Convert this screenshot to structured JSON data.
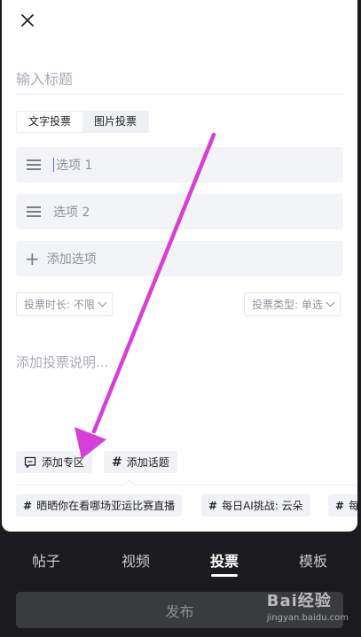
{
  "header": {
    "close_icon": "close-icon"
  },
  "title_input": {
    "placeholder": "输入标题"
  },
  "vote_type": {
    "tabs": [
      {
        "label": "文字投票",
        "active": true
      },
      {
        "label": "图片投票",
        "active": false
      }
    ]
  },
  "options": [
    {
      "placeholder": "选项 1",
      "focused": true
    },
    {
      "placeholder": "选项 2",
      "focused": false
    }
  ],
  "add_option": {
    "label": "添加选项"
  },
  "duration_select": {
    "label": "投票时长: 不限"
  },
  "type_select": {
    "label": "投票类型: 单选"
  },
  "description": {
    "placeholder": "添加投票说明..."
  },
  "actions": {
    "add_zone": "添加专区",
    "add_topic": "添加话题"
  },
  "recommended_topics": [
    "晒晒你在看哪场亚运比赛直播",
    "每日AI挑战: 云朵",
    "每"
  ],
  "bottom_tabs": [
    "帖子",
    "视频",
    "投票",
    "模板"
  ],
  "active_tab": "投票",
  "publish": {
    "label": "发布"
  },
  "watermark": {
    "main": "Bai经验",
    "sub": "jingyan.baidu.com"
  },
  "colors": {
    "annotation_arrow": "#d63fd8",
    "panel_bg": "#ffffff",
    "page_bg": "#1b1b1d",
    "cursor": "#3f7fe8"
  }
}
